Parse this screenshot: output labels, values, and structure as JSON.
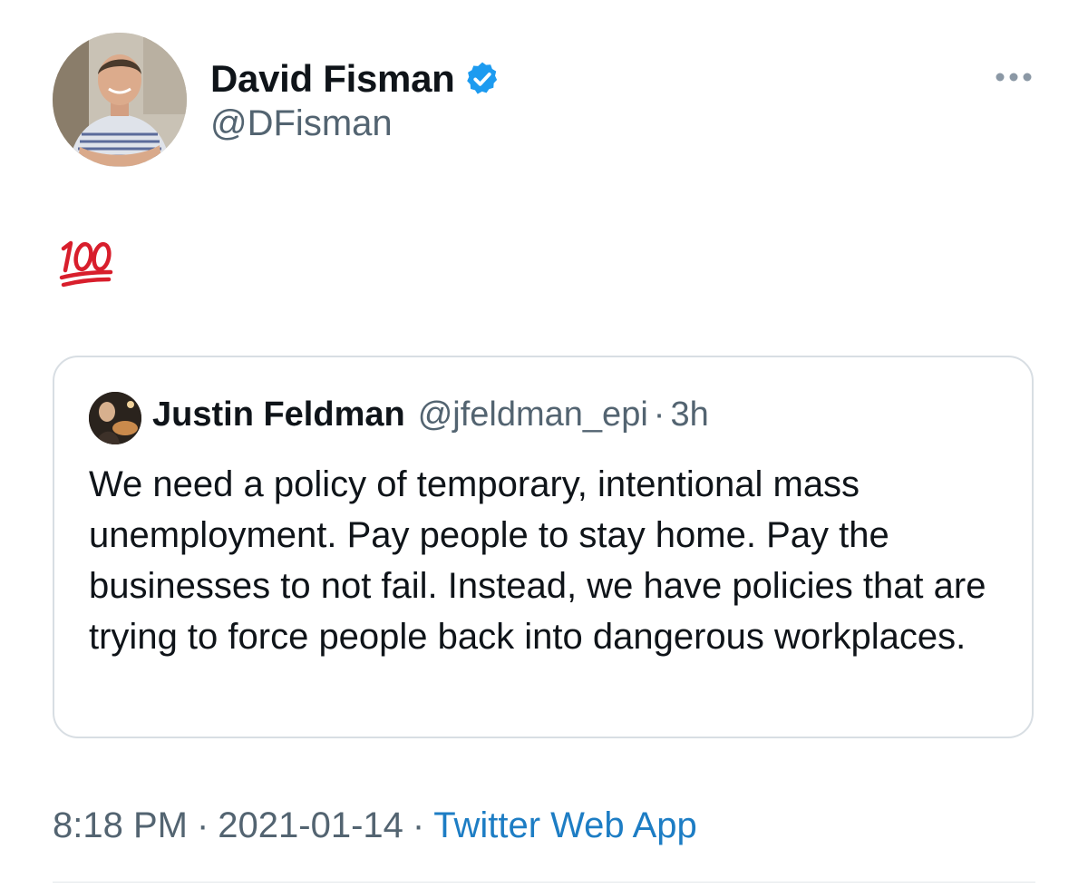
{
  "tweet": {
    "author": {
      "name": "David Fisman",
      "handle": "@DFisman",
      "verified": true,
      "avatar": "profile-photo"
    },
    "more_icon": "more-options-icon",
    "body_emoji": "💯",
    "quoted": {
      "author_name": "Justin Feldman",
      "author_handle": "@jfeldman_epi",
      "separator": "·",
      "time": "3h",
      "avatar": "profile-photo",
      "text": "We need a policy of temporary, intentional mass unemployment. Pay people to stay home. Pay the businesses to not fail. Instead, we have policies that are trying to force people back into dangerous workplaces."
    },
    "meta": {
      "time": "8:18 PM",
      "separator": "·",
      "date": "2021-01-14",
      "source": "Twitter Web App"
    }
  },
  "colors": {
    "text": "#0f1419",
    "muted": "#536471",
    "link": "#1d7dc4",
    "verified": "#1d9bf0",
    "border": "#d8dee3",
    "emoji_red": "#d81e2c"
  }
}
